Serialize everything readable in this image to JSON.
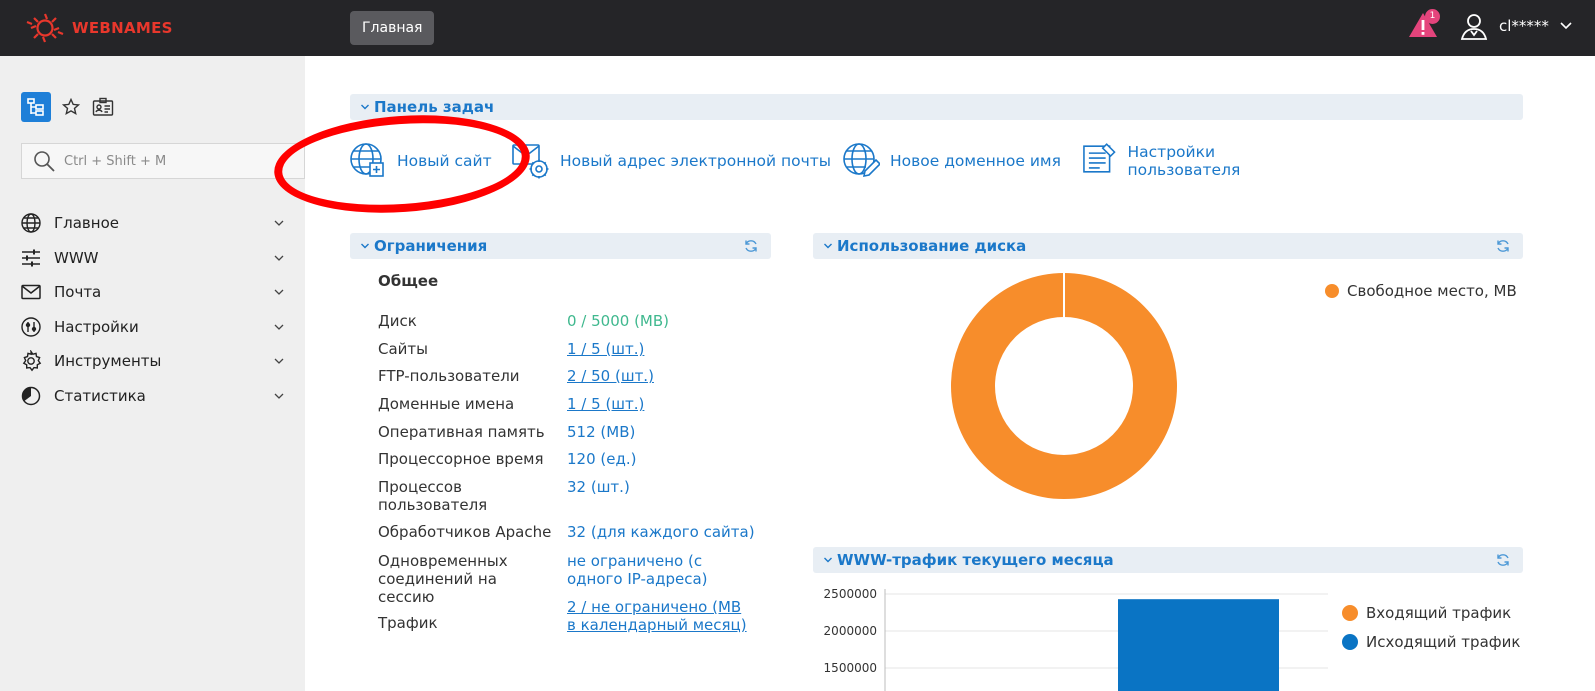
{
  "header": {
    "logo_text": "WEBNAMES",
    "tab_home": "Главная",
    "alert_count": "1",
    "user_name": "cl*****",
    "colors": {
      "bar": "#252528",
      "brand": "#e8372c",
      "alert": "#e4447c"
    }
  },
  "sidebar": {
    "search_placeholder": "Ctrl + Shift + M",
    "items": [
      {
        "label": "Главное",
        "icon": "globe-icon"
      },
      {
        "label": "WWW",
        "icon": "sliders-icon"
      },
      {
        "label": "Почта",
        "icon": "mail-icon"
      },
      {
        "label": "Настройки",
        "icon": "settings-dial-icon"
      },
      {
        "label": "Инструменты",
        "icon": "gear-icon"
      },
      {
        "label": "Статистика",
        "icon": "pie-chart-icon"
      }
    ]
  },
  "taskbar": {
    "title": "Панель задач",
    "items": [
      {
        "label": "Новый сайт",
        "icon": "globe-plus-icon"
      },
      {
        "label": "Новый адрес электронной почты",
        "icon": "mail-gear-icon"
      },
      {
        "label": "Новое доменное имя",
        "icon": "globe-pen-icon"
      },
      {
        "label": "Настройки пользователя",
        "icon": "user-settings-icon"
      }
    ]
  },
  "limits": {
    "title": "Ограничения",
    "section": "Общее",
    "rows": [
      {
        "label": "Диск",
        "value": "0 / 5000 (MB)"
      },
      {
        "label": "Сайты",
        "value": "1 / 5 (шт.)"
      },
      {
        "label": "FTP-пользователи",
        "value": "2 / 50 (шт.)"
      },
      {
        "label": "Доменные имена",
        "value": "1 / 5 (шт.)"
      },
      {
        "label": "Оперативная память",
        "value": "512 (MB)"
      },
      {
        "label": "Процессорное время",
        "value": "120 (ед.)"
      },
      {
        "label": "Процессов пользователя",
        "value": "32 (шт.)"
      },
      {
        "label": "Обработчиков Apache",
        "value": "32 (для каждого сайта)"
      },
      {
        "label": "Одновременных соединений на сессию",
        "value": "не ограничено (с одного IP-адреса)"
      },
      {
        "label": "Трафик",
        "value": "2 / не ограничено (MB в календарный месяц)"
      }
    ]
  },
  "disk": {
    "title": "Использование диска"
  },
  "traffic": {
    "title": "WWW-трафик текущего месяца"
  },
  "chart_data": [
    {
      "type": "pie",
      "donut": true,
      "legend_position": "top-right",
      "series": [
        {
          "name": "Свободное место, MB",
          "value": 5000,
          "color": "#f78d2b"
        }
      ]
    },
    {
      "type": "bar",
      "legend_position": "right",
      "y_ticks": [
        "2500000",
        "2000000",
        "1500000"
      ],
      "ylim": [
        1500000,
        2500000
      ],
      "grid": true,
      "series": [
        {
          "name": "Входящий трафик",
          "color": "#f78d2b",
          "values": []
        },
        {
          "name": "Исходящий трафик",
          "color": "#0a74c4",
          "values": [
            2430000
          ]
        }
      ]
    }
  ]
}
